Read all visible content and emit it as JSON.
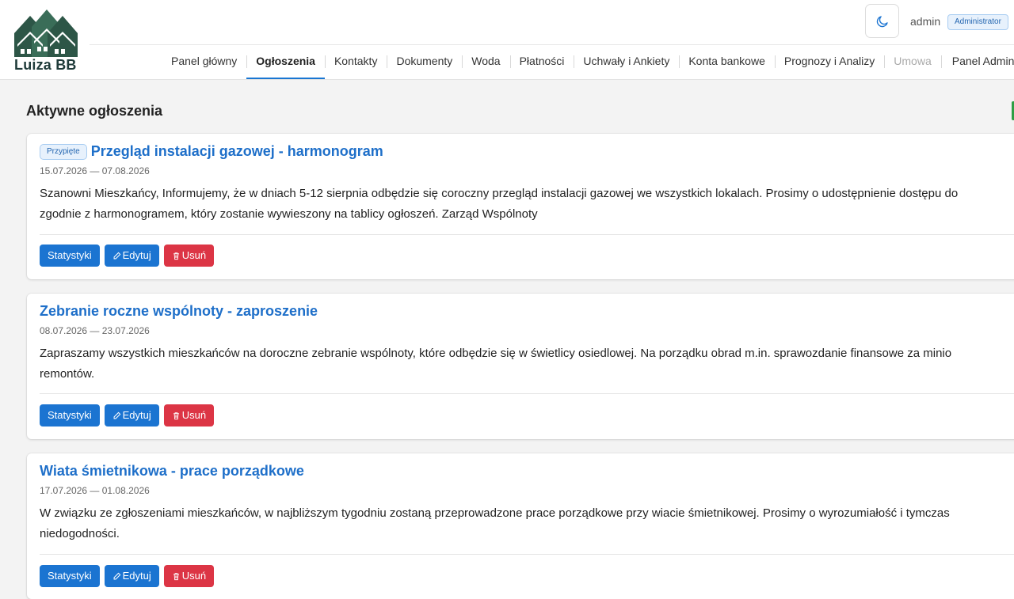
{
  "app": {
    "logo_text": "Luiza BB",
    "user_name": "admin",
    "role_badge": "Administrator"
  },
  "nav": {
    "items": [
      {
        "label": "Panel główny"
      },
      {
        "label": "Ogłoszenia"
      },
      {
        "label": "Kontakty"
      },
      {
        "label": "Dokumenty"
      },
      {
        "label": "Woda"
      },
      {
        "label": "Płatności"
      },
      {
        "label": "Uchwały i Ankiety"
      },
      {
        "label": "Konta bankowe"
      },
      {
        "label": "Prognozy i Analizy"
      },
      {
        "label": "Umowa"
      },
      {
        "label": "Panel Admin"
      }
    ],
    "active": "Ogłoszenia",
    "disabled": "Umowa"
  },
  "main": {
    "title": "Aktywne ogłoszenia"
  },
  "announcements": [
    {
      "pinned_label": "Przypięte",
      "title": "Przegląd instalacji gazowej - harmonogram",
      "dates": "15.07.2026 — 07.08.2026",
      "body_line1": "Szanowni Mieszkańcy, Informujemy, że w dniach 5-12 sierpnia odbędzie się coroczny przegląd instalacji gazowej we wszystkich lokalach. Prosimy o udostępnienie dostępu do",
      "body_line2": "zgodnie z harmonogramem, który zostanie wywieszony na tablicy ogłoszeń. Zarząd Wspólnoty"
    },
    {
      "pinned_label": "",
      "title": "Zebranie roczne wspólnoty - zaproszenie",
      "dates": "08.07.2026 — 23.07.2026",
      "body_line1": "Zapraszamy wszystkich mieszkańców na doroczne zebranie wspólnoty, które odbędzie się w świetlicy osiedlowej. Na porządku obrad m.in. sprawozdanie finansowe za minio",
      "body_line2": "remontów."
    },
    {
      "pinned_label": "",
      "title": "Wiata śmietnikowa - prace porządkowe",
      "dates": "17.07.2026 — 01.08.2026",
      "body_line1": "W związku ze zgłoszeniami mieszkańców, w najbliższym tygodniu zostaną przeprowadzone prace porządkowe przy wiacie śmietnikowej. Prosimy o wyrozumiałość i tymczas",
      "body_line2": "niedogodności."
    }
  ],
  "buttons": {
    "stats": "Statystyki",
    "edit": "Edytuj",
    "delete": "Usuń"
  },
  "colors": {
    "accent": "#1b74d1",
    "danger": "#dc3545",
    "logo_green": "#2f5a4c"
  }
}
